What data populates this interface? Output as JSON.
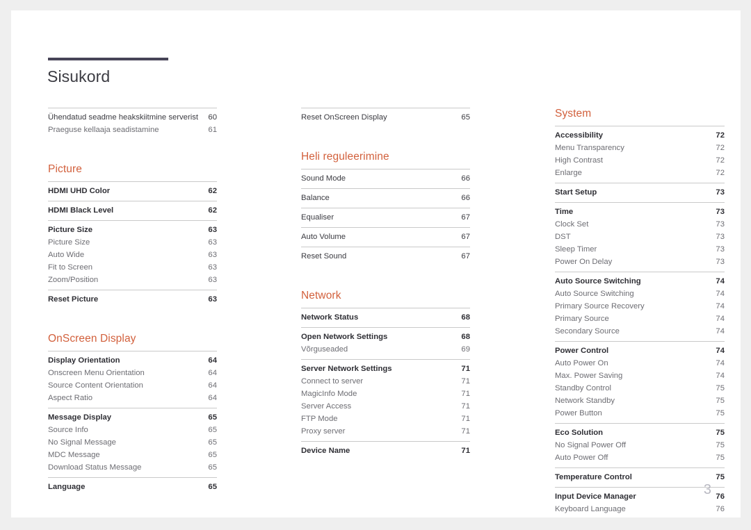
{
  "document": {
    "title": "Sisukord",
    "page_number": "3",
    "accent_color": "#d2603c",
    "rule_color": "#474457"
  },
  "columns": [
    {
      "name": "column-left",
      "blocks": [
        {
          "type": "group",
          "rows": [
            {
              "label": "Ühendatud seadme heakskiitmine serverist",
              "page": "60",
              "level": "plain"
            },
            {
              "label": "Praeguse kellaaja seadistamine",
              "page": "61",
              "level": "child"
            }
          ]
        },
        {
          "type": "heading",
          "label": "Picture",
          "spaced": true
        },
        {
          "type": "group",
          "rows": [
            {
              "label": "HDMI UHD Color",
              "page": "62",
              "level": "parent"
            }
          ]
        },
        {
          "type": "group",
          "rows": [
            {
              "label": "HDMI Black Level",
              "page": "62",
              "level": "parent"
            }
          ]
        },
        {
          "type": "group",
          "rows": [
            {
              "label": "Picture Size",
              "page": "63",
              "level": "parent"
            },
            {
              "label": "Picture Size",
              "page": "63",
              "level": "child"
            },
            {
              "label": "Auto Wide",
              "page": "63",
              "level": "child"
            },
            {
              "label": "Fit to Screen",
              "page": "63",
              "level": "child"
            },
            {
              "label": "Zoom/Position",
              "page": "63",
              "level": "child"
            }
          ]
        },
        {
          "type": "group",
          "rows": [
            {
              "label": "Reset Picture",
              "page": "63",
              "level": "parent"
            }
          ]
        },
        {
          "type": "heading",
          "label": "OnScreen Display",
          "spaced": true
        },
        {
          "type": "group",
          "rows": [
            {
              "label": "Display Orientation",
              "page": "64",
              "level": "parent"
            },
            {
              "label": "Onscreen Menu Orientation",
              "page": "64",
              "level": "child"
            },
            {
              "label": "Source Content Orientation",
              "page": "64",
              "level": "child"
            },
            {
              "label": "Aspect Ratio",
              "page": "64",
              "level": "child"
            }
          ]
        },
        {
          "type": "group",
          "rows": [
            {
              "label": "Message Display",
              "page": "65",
              "level": "parent"
            },
            {
              "label": "Source Info",
              "page": "65",
              "level": "child"
            },
            {
              "label": "No Signal Message",
              "page": "65",
              "level": "child"
            },
            {
              "label": "MDC Message",
              "page": "65",
              "level": "child"
            },
            {
              "label": "Download Status Message",
              "page": "65",
              "level": "child"
            }
          ]
        },
        {
          "type": "group",
          "rows": [
            {
              "label": "Language",
              "page": "65",
              "level": "parent"
            }
          ]
        }
      ]
    },
    {
      "name": "column-middle",
      "blocks": [
        {
          "type": "group",
          "rows": [
            {
              "label": "Reset OnScreen Display",
              "page": "65",
              "level": "plain"
            }
          ]
        },
        {
          "type": "heading",
          "label": "Heli reguleerimine",
          "spaced": true
        },
        {
          "type": "group",
          "rows": [
            {
              "label": "Sound Mode",
              "page": "66",
              "level": "plain"
            }
          ]
        },
        {
          "type": "group",
          "rows": [
            {
              "label": "Balance",
              "page": "66",
              "level": "plain"
            }
          ]
        },
        {
          "type": "group",
          "rows": [
            {
              "label": "Equaliser",
              "page": "67",
              "level": "plain"
            }
          ]
        },
        {
          "type": "group",
          "rows": [
            {
              "label": "Auto Volume",
              "page": "67",
              "level": "plain"
            }
          ]
        },
        {
          "type": "group",
          "rows": [
            {
              "label": "Reset Sound",
              "page": "67",
              "level": "plain"
            }
          ]
        },
        {
          "type": "heading",
          "label": "Network",
          "spaced": true
        },
        {
          "type": "group",
          "rows": [
            {
              "label": "Network Status",
              "page": "68",
              "level": "parent"
            }
          ]
        },
        {
          "type": "group",
          "rows": [
            {
              "label": "Open Network Settings",
              "page": "68",
              "level": "parent"
            },
            {
              "label": "Võrguseaded",
              "page": "69",
              "level": "child"
            }
          ]
        },
        {
          "type": "group",
          "rows": [
            {
              "label": "Server Network Settings",
              "page": "71",
              "level": "parent"
            },
            {
              "label": "Connect to server",
              "page": "71",
              "level": "child"
            },
            {
              "label": "MagicInfo Mode",
              "page": "71",
              "level": "child"
            },
            {
              "label": "Server Access",
              "page": "71",
              "level": "child"
            },
            {
              "label": "FTP Mode",
              "page": "71",
              "level": "child"
            },
            {
              "label": "Proxy server",
              "page": "71",
              "level": "child"
            }
          ]
        },
        {
          "type": "group",
          "rows": [
            {
              "label": "Device Name",
              "page": "71",
              "level": "parent"
            }
          ]
        }
      ]
    },
    {
      "name": "column-right",
      "blocks": [
        {
          "type": "heading",
          "label": "System",
          "spaced": false
        },
        {
          "type": "group",
          "rows": [
            {
              "label": "Accessibility",
              "page": "72",
              "level": "parent"
            },
            {
              "label": "Menu Transparency",
              "page": "72",
              "level": "child"
            },
            {
              "label": "High Contrast",
              "page": "72",
              "level": "child"
            },
            {
              "label": "Enlarge",
              "page": "72",
              "level": "child"
            }
          ]
        },
        {
          "type": "group",
          "rows": [
            {
              "label": "Start Setup",
              "page": "73",
              "level": "parent"
            }
          ]
        },
        {
          "type": "group",
          "rows": [
            {
              "label": "Time",
              "page": "73",
              "level": "parent"
            },
            {
              "label": "Clock Set",
              "page": "73",
              "level": "child"
            },
            {
              "label": "DST",
              "page": "73",
              "level": "child"
            },
            {
              "label": "Sleep Timer",
              "page": "73",
              "level": "child"
            },
            {
              "label": "Power On Delay",
              "page": "73",
              "level": "child"
            }
          ]
        },
        {
          "type": "group",
          "rows": [
            {
              "label": "Auto Source Switching",
              "page": "74",
              "level": "parent"
            },
            {
              "label": "Auto Source Switching",
              "page": "74",
              "level": "child"
            },
            {
              "label": "Primary Source Recovery",
              "page": "74",
              "level": "child"
            },
            {
              "label": "Primary Source",
              "page": "74",
              "level": "child"
            },
            {
              "label": "Secondary Source",
              "page": "74",
              "level": "child"
            }
          ]
        },
        {
          "type": "group",
          "rows": [
            {
              "label": "Power Control",
              "page": "74",
              "level": "parent"
            },
            {
              "label": "Auto Power On",
              "page": "74",
              "level": "child"
            },
            {
              "label": "Max. Power Saving",
              "page": "74",
              "level": "child"
            },
            {
              "label": "Standby Control",
              "page": "75",
              "level": "child"
            },
            {
              "label": "Network Standby",
              "page": "75",
              "level": "child"
            },
            {
              "label": "Power Button",
              "page": "75",
              "level": "child"
            }
          ]
        },
        {
          "type": "group",
          "rows": [
            {
              "label": "Eco Solution",
              "page": "75",
              "level": "parent"
            },
            {
              "label": "No Signal Power Off",
              "page": "75",
              "level": "child"
            },
            {
              "label": "Auto Power Off",
              "page": "75",
              "level": "child"
            }
          ]
        },
        {
          "type": "group",
          "rows": [
            {
              "label": "Temperature Control",
              "page": "75",
              "level": "parent"
            }
          ]
        },
        {
          "type": "group",
          "rows": [
            {
              "label": "Input Device Manager",
              "page": "76",
              "level": "parent"
            },
            {
              "label": "Keyboard Language",
              "page": "76",
              "level": "child"
            }
          ]
        }
      ]
    }
  ]
}
